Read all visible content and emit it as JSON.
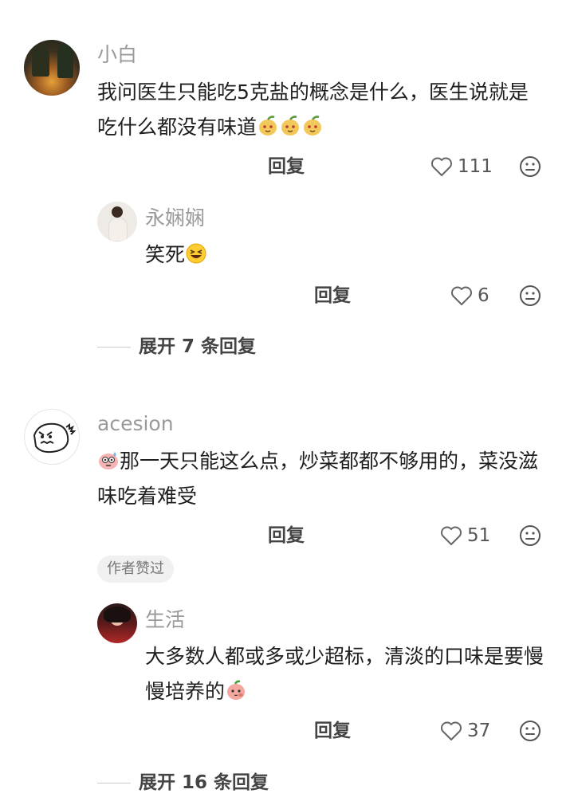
{
  "comments": [
    {
      "user": "小白",
      "text": "我问医生只能吃5克盐的概念是什么，医生说就是吃什么都没有味道",
      "reply_label": "回复",
      "likes": "111",
      "replies": [
        {
          "user": "永娴娴",
          "text": "笑死",
          "reply_label": "回复",
          "likes": "6"
        }
      ],
      "expand_label": "展开 7 条回复"
    },
    {
      "user": "acesion",
      "text": "那一天只能这么点，炒菜都都不够用的，菜没滋味吃着难受",
      "reply_label": "回复",
      "likes": "51",
      "badge": "作者赞过",
      "replies": [
        {
          "user": "生活",
          "text": "大多数人都或多或少超标，清淡的口味是要慢慢培养的",
          "reply_label": "回复",
          "likes": "37"
        }
      ],
      "expand_label": "展开 16 条回复"
    }
  ],
  "icons": {
    "like": "heart-outline-icon",
    "react": "smiley-face-icon",
    "sticker_pear": "pear-sticker-icon",
    "sticker_laugh": "laughing-emoji-icon",
    "sticker_sweat": "sweat-emoji-icon",
    "sticker_peach": "peach-sticker-icon"
  }
}
